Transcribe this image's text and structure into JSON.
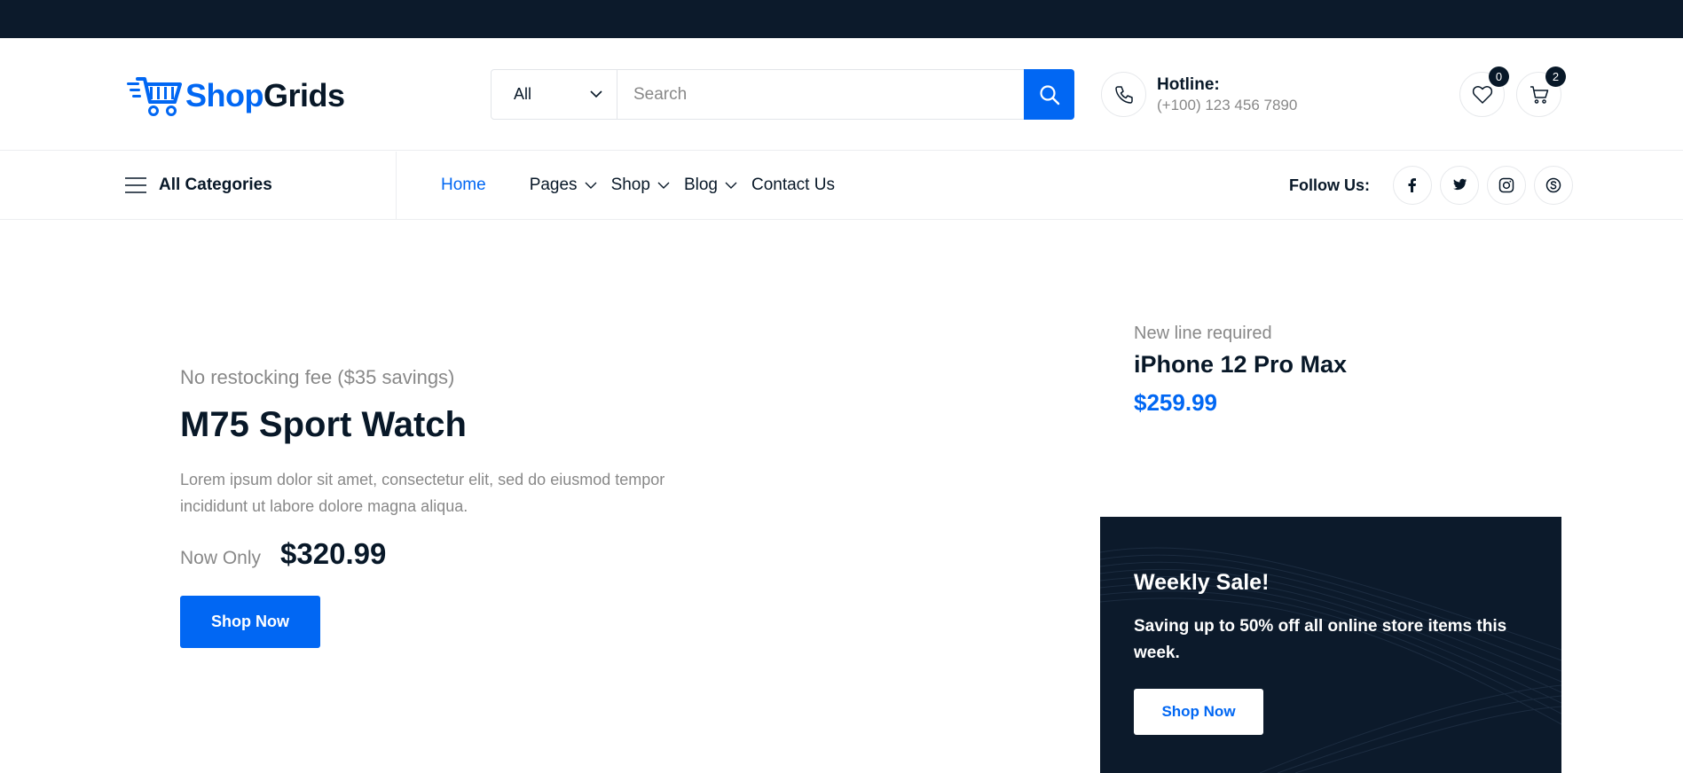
{
  "brand": {
    "shop": "Shop",
    "grids": "Grids"
  },
  "search": {
    "category": "All",
    "placeholder": "Search"
  },
  "hotline": {
    "label": "Hotline:",
    "number": "(+100) 123 456 7890"
  },
  "counts": {
    "wishlist": "0",
    "cart": "2"
  },
  "nav": {
    "all_categories": "All Categories",
    "items": [
      {
        "label": "Home",
        "active": true
      },
      {
        "label": "Pages",
        "dropdown": true
      },
      {
        "label": "Shop",
        "dropdown": true
      },
      {
        "label": "Blog",
        "dropdown": true
      },
      {
        "label": "Contact Us"
      }
    ],
    "follow_label": "Follow Us:",
    "social_icons": [
      "facebook-icon",
      "twitter-icon",
      "instagram-icon",
      "skype-icon"
    ]
  },
  "hero": {
    "subtitle": "No restocking fee ($35 savings)",
    "title": "M75 Sport Watch",
    "description": "Lorem ipsum dolor sit amet, consectetur elit, sed do eiusmod tempor incididunt ut labore dolore magna aliqua.",
    "price_label": "Now Only",
    "price": "$320.99",
    "button": "Shop Now"
  },
  "side_product": {
    "subtitle": "New line required",
    "title": "iPhone 12 Pro Max",
    "price": "$259.99"
  },
  "promo": {
    "title": "Weekly Sale!",
    "text": "Saving up to 50% off all online store items this week.",
    "button": "Shop Now"
  },
  "colors": {
    "accent": "#0167f3",
    "dark": "#081828",
    "topbar": "#0c1a2b",
    "muted": "#888888"
  }
}
